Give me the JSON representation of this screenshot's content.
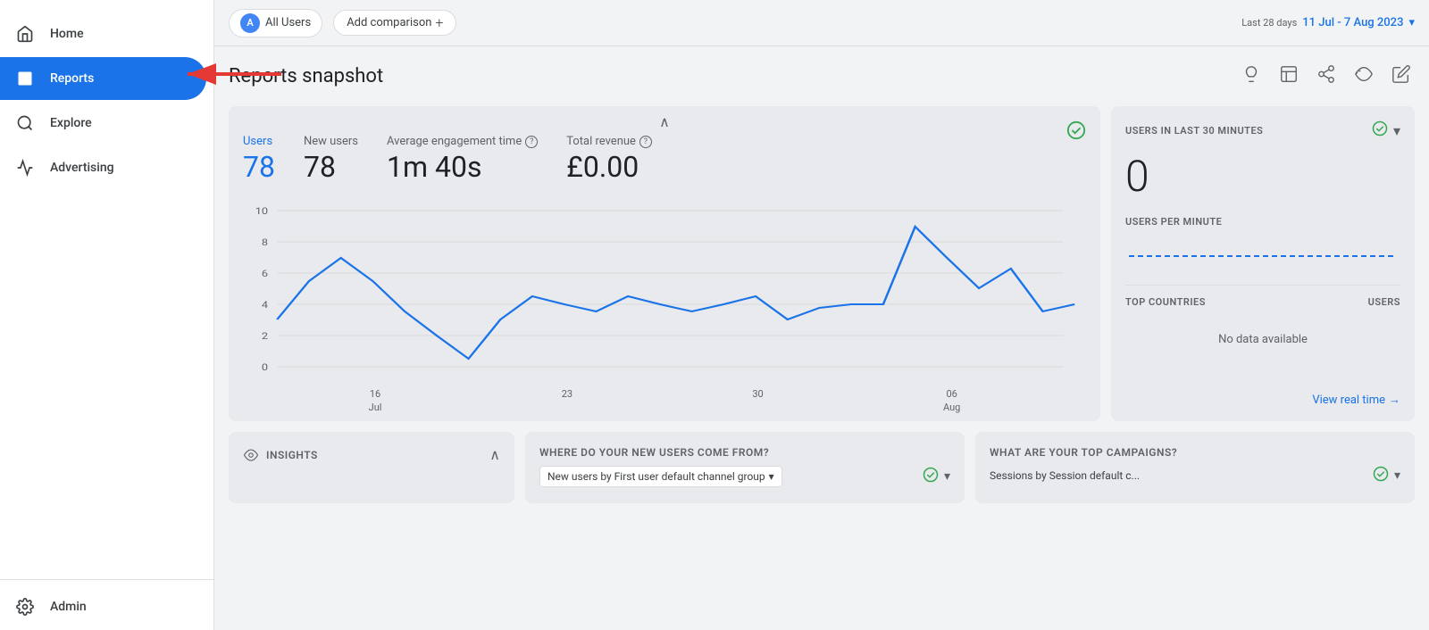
{
  "sidebar": {
    "items": [
      {
        "id": "home",
        "label": "Home",
        "icon": "⌂",
        "active": false
      },
      {
        "id": "reports",
        "label": "Reports",
        "icon": "📊",
        "active": true
      },
      {
        "id": "explore",
        "label": "Explore",
        "icon": "🔍",
        "active": false
      },
      {
        "id": "advertising",
        "label": "Advertising",
        "icon": "📡",
        "active": false
      }
    ],
    "admin_label": "Admin",
    "admin_icon": "⚙"
  },
  "topbar": {
    "all_users_label": "All Users",
    "all_users_avatar": "A",
    "add_comparison_label": "Add comparison",
    "add_comparison_icon": "+",
    "date_range_label": "Last 28 days",
    "date_range_value": "11 Jul - 7 Aug 2023",
    "date_range_chevron": "▾"
  },
  "page": {
    "title": "Reports snapshot",
    "actions": {
      "lightbulb": "💡",
      "grid": "⊞",
      "share": "↗",
      "chart": "〜",
      "edit": "✏"
    }
  },
  "metrics": {
    "users_label": "Users",
    "users_value": "78",
    "new_users_label": "New users",
    "new_users_value": "78",
    "avg_engagement_label": "Average engagement time",
    "avg_engagement_value": "1m 40s",
    "total_revenue_label": "Total revenue",
    "total_revenue_value": "£0.00",
    "check_icon": "✓"
  },
  "chart": {
    "x_labels": [
      {
        "date": "16",
        "month": "Jul"
      },
      {
        "date": "23",
        "month": ""
      },
      {
        "date": "30",
        "month": ""
      },
      {
        "date": "06",
        "month": "Aug"
      }
    ],
    "y_labels": [
      "10",
      "8",
      "6",
      "4",
      "2",
      "0"
    ],
    "data_points": [
      3,
      5.5,
      7,
      5,
      3.5,
      2,
      0.5,
      3.5,
      5,
      4,
      3,
      5,
      4,
      3.5,
      4.5,
      5,
      3,
      4,
      4.5,
      4,
      9,
      7,
      5,
      6,
      3.5,
      3
    ]
  },
  "realtime": {
    "title": "USERS IN LAST 30 MINUTES",
    "value": "0",
    "sub_title": "USERS PER MINUTE",
    "top_countries_label": "TOP COUNTRIES",
    "users_col_label": "USERS",
    "no_data_message": "No data available",
    "view_realtime_label": "View real time",
    "view_realtime_arrow": "→"
  },
  "bottom": {
    "section1_label": "WHERE DO YOUR NEW USERS COME FROM?",
    "section2_label": "WHAT ARE YOUR TOP CAMPAIGNS?",
    "insights_label": "Insights",
    "insights_icon": "〜",
    "new_users_dropdown": "New users by First user default channel group",
    "sessions_dropdown": "Sessions  by  Session default c...",
    "collapse_icon": "∧"
  }
}
